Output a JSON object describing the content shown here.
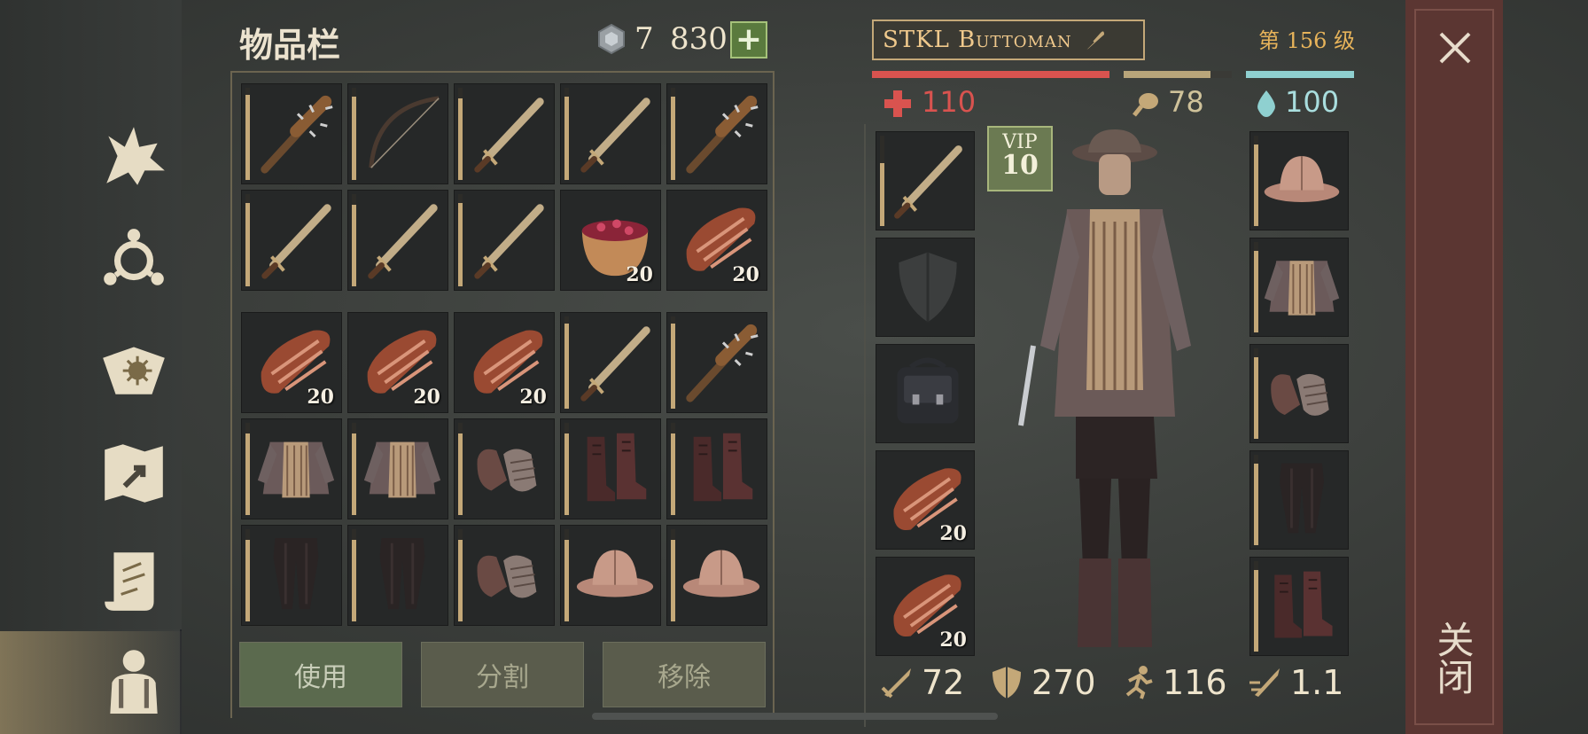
{
  "inventory": {
    "title": "物品栏",
    "gem_count": "7",
    "coin_count": "830",
    "add_symbol": "+",
    "slots": [
      {
        "item": "spiked-club",
        "qty": "",
        "durability": 0.92
      },
      {
        "item": "bow",
        "qty": "",
        "durability": 0.9
      },
      {
        "item": "sword",
        "qty": "",
        "durability": 0.88
      },
      {
        "item": "sword",
        "qty": "",
        "durability": 0.9
      },
      {
        "item": "spiked-club",
        "qty": "",
        "durability": 0.9
      },
      {
        "item": "sword",
        "qty": "",
        "durability": 0.9
      },
      {
        "item": "sword",
        "qty": "",
        "durability": 0.88
      },
      {
        "item": "sword",
        "qty": "",
        "durability": 0.9
      },
      {
        "item": "berry-bowl",
        "qty": "20",
        "durability": 0
      },
      {
        "item": "meat",
        "qty": "20",
        "durability": 0
      },
      {
        "item": "meat",
        "qty": "20",
        "durability": 0
      },
      {
        "item": "meat",
        "qty": "20",
        "durability": 0
      },
      {
        "item": "meat",
        "qty": "20",
        "durability": 0
      },
      {
        "item": "sword",
        "qty": "",
        "durability": 0.92
      },
      {
        "item": "spiked-club",
        "qty": "",
        "durability": 0.92
      },
      {
        "item": "chainmail",
        "qty": "",
        "durability": 0.88
      },
      {
        "item": "chainmail",
        "qty": "",
        "durability": 0.88
      },
      {
        "item": "gloves",
        "qty": "",
        "durability": 0.88
      },
      {
        "item": "boots",
        "qty": "",
        "durability": 0.88
      },
      {
        "item": "boots",
        "qty": "",
        "durability": 0.88
      },
      {
        "item": "pants",
        "qty": "",
        "durability": 0.88
      },
      {
        "item": "pants",
        "qty": "",
        "durability": 0.88
      },
      {
        "item": "gloves",
        "qty": "",
        "durability": 0.88
      },
      {
        "item": "helmet",
        "qty": "",
        "durability": 0.88
      },
      {
        "item": "helmet",
        "qty": "",
        "durability": 0.88
      }
    ],
    "buttons": {
      "use": "使用",
      "split": "分割",
      "remove": "移除"
    }
  },
  "character": {
    "name": "STKL Buttoman",
    "level": "第 156 级",
    "health": "110",
    "food": "78",
    "water": "100",
    "health_fill": 1.0,
    "food_fill": 0.8,
    "water_fill": 1.0,
    "vip_label": "VIP",
    "vip_level": "10",
    "left_equip": [
      {
        "item": "sword",
        "qty": "",
        "durability": 0.7
      },
      {
        "item": "shield-empty",
        "qty": "",
        "durability": 0
      },
      {
        "item": "backpack",
        "qty": "",
        "durability": 0
      },
      {
        "item": "meat",
        "qty": "20",
        "durability": 0
      },
      {
        "item": "meat",
        "qty": "20",
        "durability": 0
      }
    ],
    "right_equip": [
      {
        "item": "helmet",
        "qty": "",
        "durability": 0.9
      },
      {
        "item": "chainmail",
        "qty": "",
        "durability": 0.9
      },
      {
        "item": "gloves",
        "qty": "",
        "durability": 0.9
      },
      {
        "item": "pants",
        "qty": "",
        "durability": 0.9
      },
      {
        "item": "boots",
        "qty": "",
        "durability": 0.9
      }
    ],
    "stats": {
      "attack": "72",
      "armor": "270",
      "speed": "116",
      "attack_speed": "1.1"
    }
  },
  "close": {
    "symbol": "✕",
    "label": "关闭"
  },
  "colors": {
    "accent": "#c4a878",
    "health": "#d9534f",
    "food": "#b8a57a",
    "water": "#8fd0d0",
    "level": "#e7b35a"
  }
}
